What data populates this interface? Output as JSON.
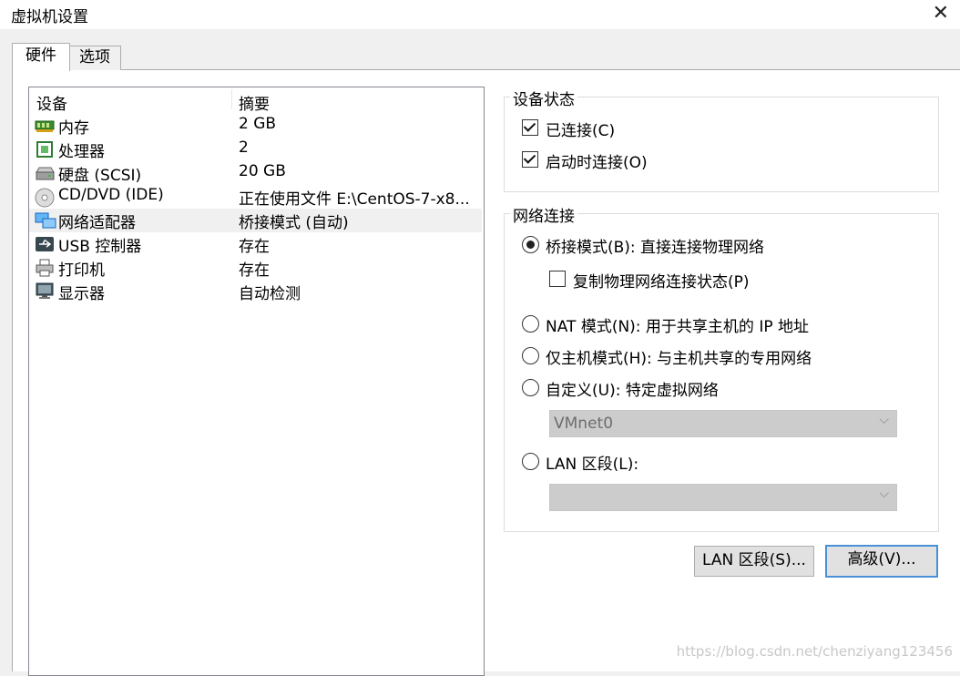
{
  "window": {
    "title": "虚拟机设置"
  },
  "tabs": [
    {
      "label": "硬件"
    },
    {
      "label": "选项"
    }
  ],
  "device_list": {
    "headers": {
      "device": "设备",
      "summary": "摘要"
    },
    "rows": [
      {
        "name": "内存",
        "summary": "2 GB",
        "icon": "memory-icon"
      },
      {
        "name": "处理器",
        "summary": "2",
        "icon": "processor-icon"
      },
      {
        "name": "硬盘 (SCSI)",
        "summary": "20 GB",
        "icon": "hard-disk-icon"
      },
      {
        "name": "CD/DVD (IDE)",
        "summary": "正在使用文件 E:\\CentOS-7-x8...",
        "icon": "cd-dvd-icon"
      },
      {
        "name": "网络适配器",
        "summary": "桥接模式 (自动)",
        "icon": "network-adapter-icon"
      },
      {
        "name": "USB 控制器",
        "summary": "存在",
        "icon": "usb-icon"
      },
      {
        "name": "打印机",
        "summary": "存在",
        "icon": "printer-icon"
      },
      {
        "name": "显示器",
        "summary": "自动检测",
        "icon": "display-icon"
      }
    ]
  },
  "device_status": {
    "legend": "设备状态",
    "connected": {
      "label": "已连接(C)",
      "checked": true
    },
    "connect_at_power_on": {
      "label": "启动时连接(O)",
      "checked": true
    }
  },
  "network": {
    "legend": "网络连接",
    "bridged": {
      "label": "桥接模式(B): 直接连接物理网络",
      "selected": true
    },
    "replicate": {
      "label": "复制物理网络连接状态(P)",
      "checked": false
    },
    "nat": {
      "label": "NAT 模式(N): 用于共享主机的 IP 地址",
      "selected": false
    },
    "hostonly": {
      "label": "仅主机模式(H): 与主机共享的专用网络",
      "selected": false
    },
    "custom": {
      "label": "自定义(U): 特定虚拟网络",
      "selected": false
    },
    "custom_select": {
      "value": "VMnet0"
    },
    "lan": {
      "label": "LAN 区段(L):",
      "selected": false
    },
    "lan_select": {
      "value": ""
    }
  },
  "buttons": {
    "lan_segments": "LAN 区段(S)...",
    "advanced": "高级(V)..."
  },
  "watermark": "https://blog.csdn.net/chenziyang123456"
}
